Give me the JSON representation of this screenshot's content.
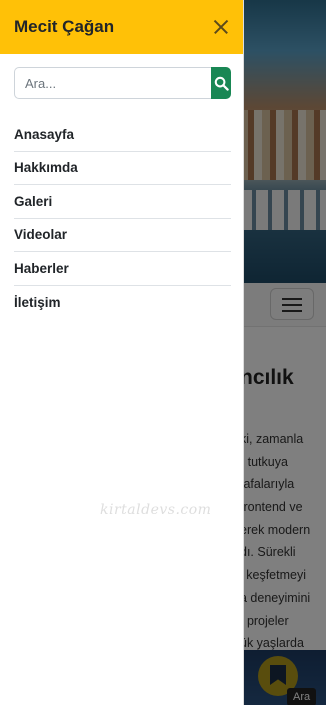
{
  "drawer": {
    "title": "Mecit Çağan",
    "search": {
      "placeholder": "Ara..."
    },
    "menu": [
      {
        "label": "Anasayfa"
      },
      {
        "label": "Hakkımda"
      },
      {
        "label": "Galeri"
      },
      {
        "label": "Videolar"
      },
      {
        "label": "Haberler"
      },
      {
        "label": "İletişim"
      }
    ]
  },
  "background": {
    "heading_fragment": "ncılık",
    "text_fragments": [
      "ki, zamanla",
      "r tutkuya",
      "fafalarıyla",
      "frontend ve",
      "erek modern",
      "dı. Sürekli",
      "i keşfetmeyi",
      "a deneyimini",
      ": projeler",
      "ük yaşlarda"
    ],
    "tooltip": "Ara"
  },
  "watermark": "kirtaldevs.com",
  "colors": {
    "header": "#ffc107",
    "search_button": "#198754",
    "fab": "#b39b1a"
  }
}
